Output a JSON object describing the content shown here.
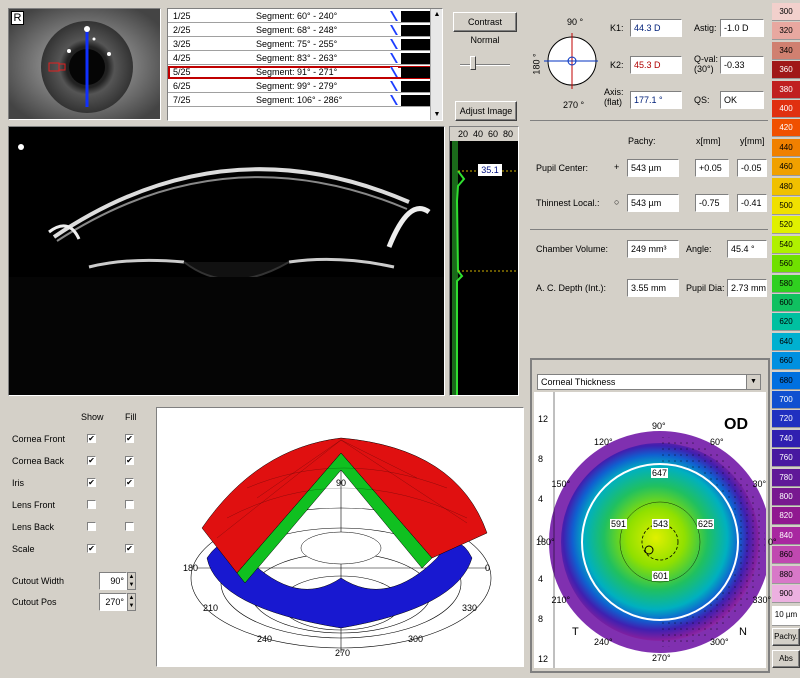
{
  "eye_label": "R",
  "segments": [
    {
      "num": "1/25",
      "seg": "Segment: 60° - 240°"
    },
    {
      "num": "2/25",
      "seg": "Segment: 68° - 248°"
    },
    {
      "num": "3/25",
      "seg": "Segment: 75° - 255°"
    },
    {
      "num": "4/25",
      "seg": "Segment: 83° - 263°"
    },
    {
      "num": "5/25",
      "seg": "Segment: 91° - 271°"
    },
    {
      "num": "6/25",
      "seg": "Segment: 99° - 279°"
    },
    {
      "num": "7/25",
      "seg": "Segment: 106° - 286°"
    }
  ],
  "selected_segment_index": 4,
  "buttons": {
    "contrast": "Contrast Normal",
    "adjust": "Adjust Image"
  },
  "densito": {
    "ticks": [
      "20",
      "40",
      "60",
      "80"
    ],
    "value": "35.1"
  },
  "keratometry": {
    "k1_label": "K1:",
    "k1": "44.3 D",
    "k2_label": "K2:",
    "k2": "45.3 D",
    "axis_label": "Axis:\n(flat)",
    "axis": "177.1 °",
    "astig_label": "Astig:",
    "astig": "-1.0 D",
    "qval_label": "Q-val:\n(30°)",
    "qval": "-0.33",
    "qs_label": "QS:",
    "qs": "OK",
    "compass": {
      "top": "90 °",
      "bottom": "270 °",
      "left": "180 °"
    }
  },
  "pachy": {
    "col_pachy": "Pachy:",
    "col_x": "x[mm]",
    "col_y": "y[mm]",
    "pupil_label": "Pupil Center:",
    "pupil_sym": "+",
    "pupil_pachy": "543 µm",
    "pupil_x": "+0.05",
    "pupil_y": "-0.05",
    "thin_label": "Thinnest Local.:",
    "thin_sym": "○",
    "thin_pachy": "543 µm",
    "thin_x": "-0.75",
    "thin_y": "-0.41"
  },
  "chamber": {
    "vol_label": "Chamber Volume:",
    "vol": "249 mm³",
    "angle_label": "Angle:",
    "angle": "45.4 °",
    "acd_label": "A. C. Depth (Int.):",
    "acd": "3.55 mm",
    "pupil_dia_label": "Pupil Dia:",
    "pupil_dia": "2.73 mm"
  },
  "controls": {
    "show": "Show",
    "fill": "Fill",
    "rows": [
      {
        "label": "Cornea Front",
        "show": "✔",
        "fill": "✔"
      },
      {
        "label": "Cornea Back",
        "show": "✔",
        "fill": "✔"
      },
      {
        "label": "Iris",
        "show": "✔",
        "fill": "✔"
      },
      {
        "label": "Lens Front",
        "show": "",
        "fill": ""
      },
      {
        "label": "Lens Back",
        "show": "",
        "fill": ""
      },
      {
        "label": "Scale",
        "show": "✔",
        "fill": "✔"
      }
    ],
    "cutout_width_label": "Cutout Width",
    "cutout_width": "90°",
    "cutout_pos_label": "Cutout Pos",
    "cutout_pos": "270°"
  },
  "model3d": {
    "labels": [
      "90",
      "180",
      "0",
      "210",
      "330",
      "240",
      "300",
      "270"
    ]
  },
  "map": {
    "dropdown": "Corneal Thickness",
    "od": "OD",
    "y_ticks": [
      "12",
      "8",
      "4",
      "0",
      "4",
      "8",
      "12"
    ],
    "values": {
      "top": "647",
      "left": "591",
      "center": "543",
      "right": "625",
      "bottom": "601"
    },
    "deg_labels": [
      "90°",
      "60°",
      "30°",
      "0°",
      "330°",
      "300°",
      "270°",
      "240°",
      "210°",
      "180°",
      "150°",
      "120°"
    ],
    "t": "T",
    "n": "N"
  },
  "scale": {
    "values": [
      "300",
      "320",
      "340",
      "360",
      "380",
      "400",
      "420",
      "440",
      "460",
      "480",
      "500",
      "520",
      "540",
      "560",
      "580",
      "600",
      "620",
      "640",
      "660",
      "680",
      "700",
      "720",
      "740",
      "760",
      "780",
      "800",
      "820",
      "840",
      "860",
      "880",
      "900"
    ],
    "colors": [
      "#f2d0cc",
      "#e8a8a0",
      "#d08070",
      "#a01818",
      "#c02020",
      "#e03010",
      "#f05000",
      "#f08000",
      "#f0a000",
      "#f0c000",
      "#f0e000",
      "#e0f000",
      "#b0f000",
      "#70e000",
      "#30d020",
      "#10c060",
      "#00c0a0",
      "#00b0d0",
      "#0090e0",
      "#0070e0",
      "#1050d0",
      "#2030c0",
      "#3020b0",
      "#4818a0",
      "#601898",
      "#781890",
      "#901890",
      "#a828a0",
      "#c048b0",
      "#d878c8",
      "#ecb0e0"
    ],
    "unit": "10 µm",
    "pachy": "Pachy.",
    "abs": "Abs"
  }
}
